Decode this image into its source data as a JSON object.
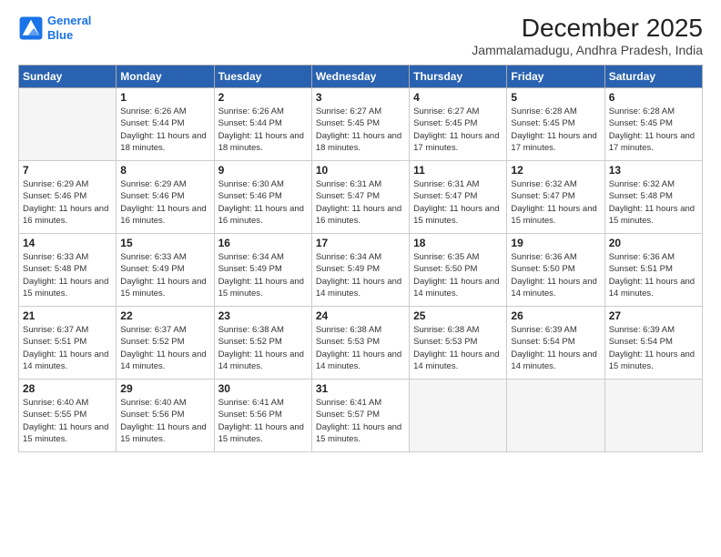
{
  "logo": {
    "line1": "General",
    "line2": "Blue"
  },
  "title": "December 2025",
  "location": "Jammalamadugu, Andhra Pradesh, India",
  "days_header": [
    "Sunday",
    "Monday",
    "Tuesday",
    "Wednesday",
    "Thursday",
    "Friday",
    "Saturday"
  ],
  "weeks": [
    [
      {
        "day": "",
        "sunrise": "",
        "sunset": "",
        "daylight": ""
      },
      {
        "day": "1",
        "sunrise": "6:26 AM",
        "sunset": "5:44 PM",
        "daylight": "11 hours and 18 minutes."
      },
      {
        "day": "2",
        "sunrise": "6:26 AM",
        "sunset": "5:44 PM",
        "daylight": "11 hours and 18 minutes."
      },
      {
        "day": "3",
        "sunrise": "6:27 AM",
        "sunset": "5:45 PM",
        "daylight": "11 hours and 18 minutes."
      },
      {
        "day": "4",
        "sunrise": "6:27 AM",
        "sunset": "5:45 PM",
        "daylight": "11 hours and 17 minutes."
      },
      {
        "day": "5",
        "sunrise": "6:28 AM",
        "sunset": "5:45 PM",
        "daylight": "11 hours and 17 minutes."
      },
      {
        "day": "6",
        "sunrise": "6:28 AM",
        "sunset": "5:45 PM",
        "daylight": "11 hours and 17 minutes."
      }
    ],
    [
      {
        "day": "7",
        "sunrise": "6:29 AM",
        "sunset": "5:46 PM",
        "daylight": "11 hours and 16 minutes."
      },
      {
        "day": "8",
        "sunrise": "6:29 AM",
        "sunset": "5:46 PM",
        "daylight": "11 hours and 16 minutes."
      },
      {
        "day": "9",
        "sunrise": "6:30 AM",
        "sunset": "5:46 PM",
        "daylight": "11 hours and 16 minutes."
      },
      {
        "day": "10",
        "sunrise": "6:31 AM",
        "sunset": "5:47 PM",
        "daylight": "11 hours and 16 minutes."
      },
      {
        "day": "11",
        "sunrise": "6:31 AM",
        "sunset": "5:47 PM",
        "daylight": "11 hours and 15 minutes."
      },
      {
        "day": "12",
        "sunrise": "6:32 AM",
        "sunset": "5:47 PM",
        "daylight": "11 hours and 15 minutes."
      },
      {
        "day": "13",
        "sunrise": "6:32 AM",
        "sunset": "5:48 PM",
        "daylight": "11 hours and 15 minutes."
      }
    ],
    [
      {
        "day": "14",
        "sunrise": "6:33 AM",
        "sunset": "5:48 PM",
        "daylight": "11 hours and 15 minutes."
      },
      {
        "day": "15",
        "sunrise": "6:33 AM",
        "sunset": "5:49 PM",
        "daylight": "11 hours and 15 minutes."
      },
      {
        "day": "16",
        "sunrise": "6:34 AM",
        "sunset": "5:49 PM",
        "daylight": "11 hours and 15 minutes."
      },
      {
        "day": "17",
        "sunrise": "6:34 AM",
        "sunset": "5:49 PM",
        "daylight": "11 hours and 14 minutes."
      },
      {
        "day": "18",
        "sunrise": "6:35 AM",
        "sunset": "5:50 PM",
        "daylight": "11 hours and 14 minutes."
      },
      {
        "day": "19",
        "sunrise": "6:36 AM",
        "sunset": "5:50 PM",
        "daylight": "11 hours and 14 minutes."
      },
      {
        "day": "20",
        "sunrise": "6:36 AM",
        "sunset": "5:51 PM",
        "daylight": "11 hours and 14 minutes."
      }
    ],
    [
      {
        "day": "21",
        "sunrise": "6:37 AM",
        "sunset": "5:51 PM",
        "daylight": "11 hours and 14 minutes."
      },
      {
        "day": "22",
        "sunrise": "6:37 AM",
        "sunset": "5:52 PM",
        "daylight": "11 hours and 14 minutes."
      },
      {
        "day": "23",
        "sunrise": "6:38 AM",
        "sunset": "5:52 PM",
        "daylight": "11 hours and 14 minutes."
      },
      {
        "day": "24",
        "sunrise": "6:38 AM",
        "sunset": "5:53 PM",
        "daylight": "11 hours and 14 minutes."
      },
      {
        "day": "25",
        "sunrise": "6:38 AM",
        "sunset": "5:53 PM",
        "daylight": "11 hours and 14 minutes."
      },
      {
        "day": "26",
        "sunrise": "6:39 AM",
        "sunset": "5:54 PM",
        "daylight": "11 hours and 14 minutes."
      },
      {
        "day": "27",
        "sunrise": "6:39 AM",
        "sunset": "5:54 PM",
        "daylight": "11 hours and 15 minutes."
      }
    ],
    [
      {
        "day": "28",
        "sunrise": "6:40 AM",
        "sunset": "5:55 PM",
        "daylight": "11 hours and 15 minutes."
      },
      {
        "day": "29",
        "sunrise": "6:40 AM",
        "sunset": "5:56 PM",
        "daylight": "11 hours and 15 minutes."
      },
      {
        "day": "30",
        "sunrise": "6:41 AM",
        "sunset": "5:56 PM",
        "daylight": "11 hours and 15 minutes."
      },
      {
        "day": "31",
        "sunrise": "6:41 AM",
        "sunset": "5:57 PM",
        "daylight": "11 hours and 15 minutes."
      },
      {
        "day": "",
        "sunrise": "",
        "sunset": "",
        "daylight": ""
      },
      {
        "day": "",
        "sunrise": "",
        "sunset": "",
        "daylight": ""
      },
      {
        "day": "",
        "sunrise": "",
        "sunset": "",
        "daylight": ""
      }
    ]
  ]
}
